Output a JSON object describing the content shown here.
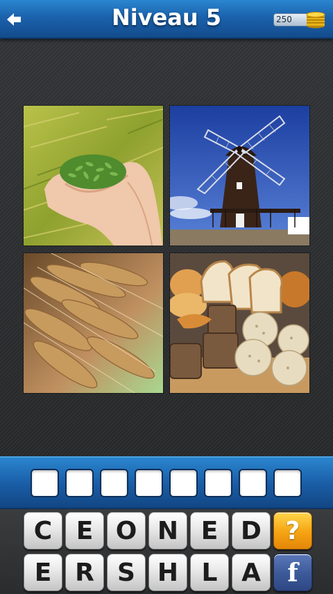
{
  "header": {
    "title": "Niveau 5",
    "coins": "250",
    "back_icon": "back-arrow-icon",
    "coin_icon": "gold-coins-icon"
  },
  "images": [
    {
      "subject": "hands holding green grain"
    },
    {
      "subject": "windmill"
    },
    {
      "subject": "wheat ears"
    },
    {
      "subject": "assorted bread"
    }
  ],
  "answer": {
    "slots": [
      "",
      "",
      "",
      "",
      "",
      "",
      "",
      ""
    ]
  },
  "keyboard": {
    "row1": [
      "C",
      "E",
      "O",
      "N",
      "E",
      "D"
    ],
    "row2": [
      "E",
      "R",
      "S",
      "H",
      "L",
      "A"
    ],
    "hint_label": "?",
    "facebook_label": "f"
  },
  "colors": {
    "bar_blue": "#1b62ad",
    "hint_orange": "#f5a312",
    "facebook_blue": "#3b5998"
  }
}
